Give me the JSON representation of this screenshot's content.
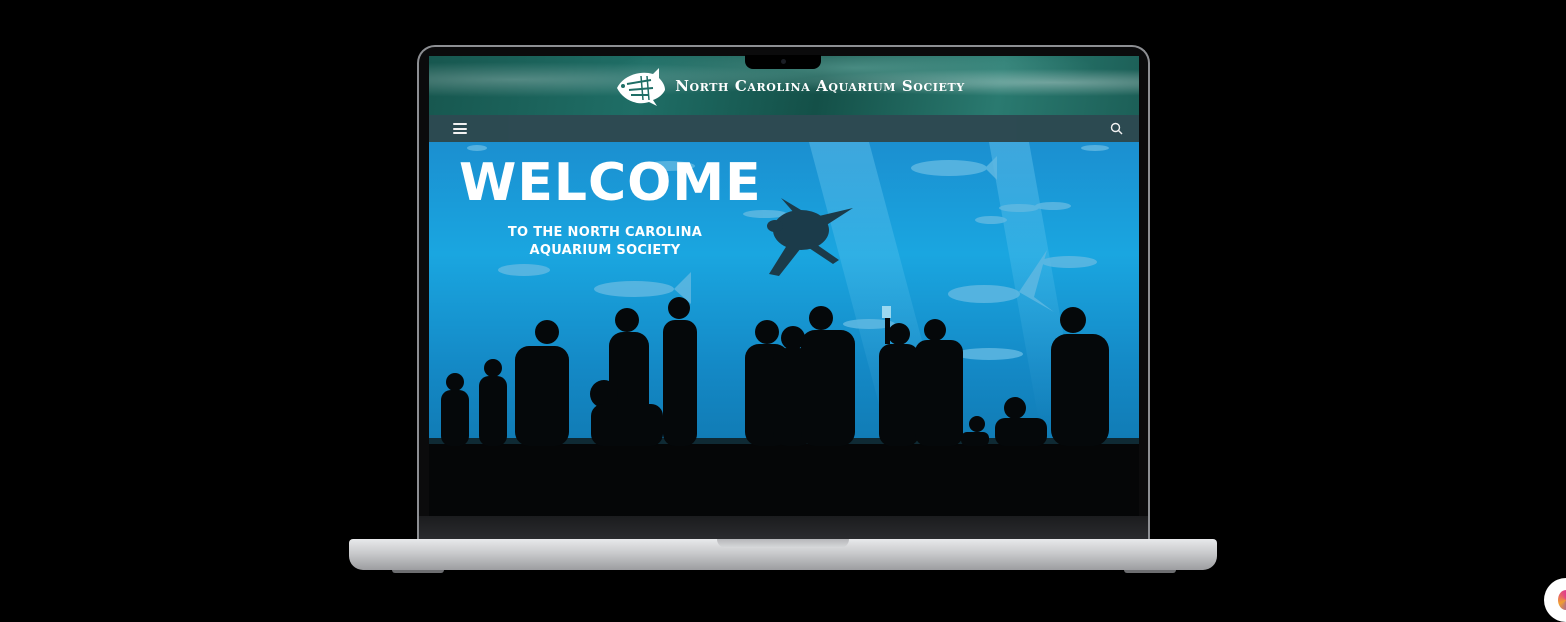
{
  "site": {
    "title": "North Carolina Aquarium Society"
  },
  "hero": {
    "headline": "WELCOME",
    "subheadline_line1": "TO THE NORTH CAROLINA",
    "subheadline_line2": "AQUARIUM SOCIETY"
  },
  "navbar": {
    "left_icon": "hamburger-menu-icon",
    "right_icon": "search-icon"
  },
  "colors": {
    "header_teal": "#1f6e66",
    "navbar": "#2f4e56",
    "hero_blue": "#1aa6e0",
    "background": "#000000"
  }
}
